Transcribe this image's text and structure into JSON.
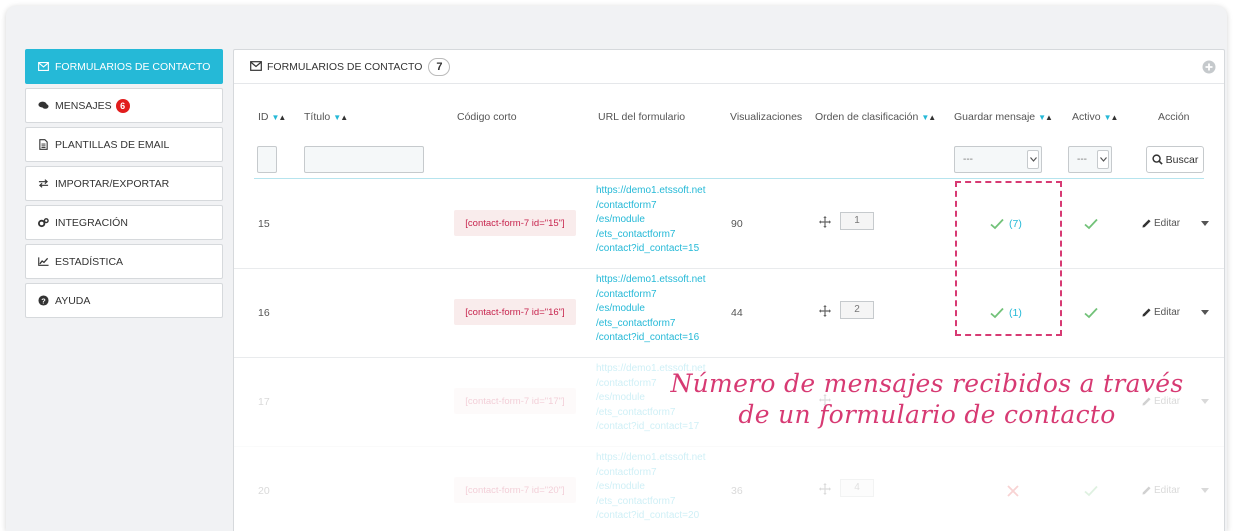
{
  "sidebar": {
    "items": [
      {
        "label": "FORMULARIOS DE CONTACTO",
        "icon": "envelope-icon",
        "active": true
      },
      {
        "label": "MENSAJES",
        "icon": "comments-icon",
        "badge": "6"
      },
      {
        "label": "PLANTILLAS DE EMAIL",
        "icon": "file-icon"
      },
      {
        "label": "IMPORTAR/EXPORTAR",
        "icon": "exchange-icon"
      },
      {
        "label": "INTEGRACIÓN",
        "icon": "cogs-icon"
      },
      {
        "label": "ESTADÍSTICA",
        "icon": "chart-icon"
      },
      {
        "label": "AYUDA",
        "icon": "question-icon"
      }
    ]
  },
  "panel": {
    "title": "FORMULARIOS DE CONTACTO",
    "count": "7"
  },
  "table": {
    "headers": {
      "id": "ID",
      "title": "Título",
      "shortcode": "Código corto",
      "url": "URL del formulario",
      "views": "Visualizaciones",
      "order": "Orden de clasificación",
      "save": "Guardar mensaje",
      "active": "Activo",
      "action": "Acción"
    },
    "filters": {
      "save_select": "---",
      "active_select": "---",
      "search_button": "Buscar"
    },
    "rows": [
      {
        "id": "15",
        "shortcode": "[contact-form-7 id=\"15\"]",
        "url_lines": [
          "https://demo1.etssoft.net",
          "/contactform7",
          "/es/module",
          "/ets_contactform7",
          "/contact?id_contact=15"
        ],
        "views": "90",
        "position": "1",
        "save": "check",
        "save_count": "(7)",
        "active": "check",
        "edit": "Editar"
      },
      {
        "id": "16",
        "shortcode": "[contact-form-7 id=\"16\"]",
        "url_lines": [
          "https://demo1.etssoft.net",
          "/contactform7",
          "/es/module",
          "/ets_contactform7",
          "/contact?id_contact=16"
        ],
        "views": "44",
        "position": "2",
        "save": "check",
        "save_count": "(1)",
        "active": "check",
        "edit": "Editar"
      },
      {
        "id": "17",
        "shortcode": "[contact-form-7 id=\"17\"]",
        "url_lines": [
          "https://demo1.etssoft.net",
          "/contactform7",
          "/es/module",
          "/ets_contactform7",
          "/contact?id_contact=17"
        ],
        "views": "",
        "position": "",
        "save": "check",
        "save_count": "",
        "active": "check",
        "edit": "Editar"
      },
      {
        "id": "20",
        "shortcode": "[contact-form-7 id=\"20\"]",
        "url_lines": [
          "https://demo1.etssoft.net",
          "/contactform7",
          "/es/module",
          "/ets_contactform7",
          "/contact?id_contact=20"
        ],
        "views": "36",
        "position": "4",
        "save": "cross",
        "save_count": "",
        "active": "check",
        "edit": "Editar"
      }
    ]
  },
  "annotation": {
    "line1": "Número de mensajes recibidos a través",
    "line2": "de un formulario de contacto"
  },
  "colors": {
    "accent": "#25b9d7",
    "badge": "#e11d1d",
    "annotation": "#d73a73",
    "check": "#72c279",
    "shortcode_bg": "#f9ecec",
    "shortcode_text": "#c7254e"
  }
}
